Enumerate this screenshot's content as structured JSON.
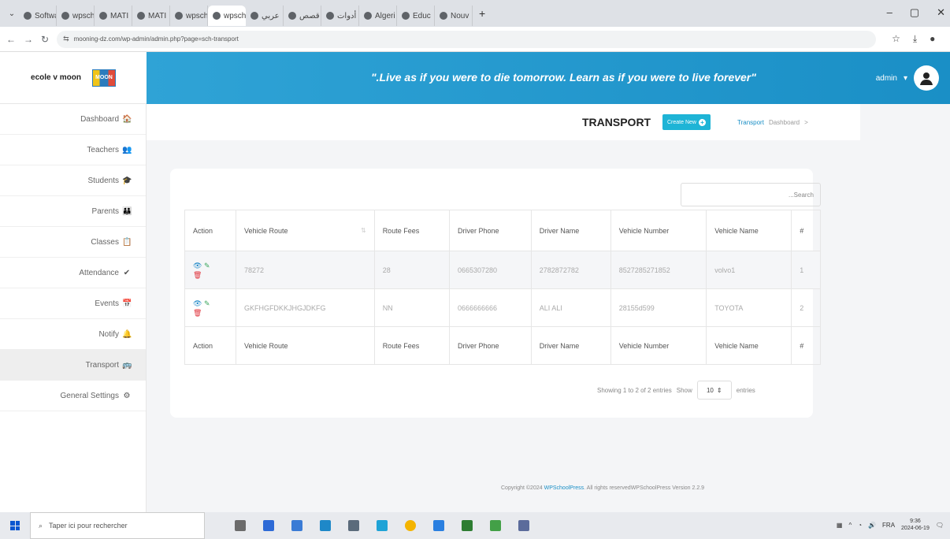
{
  "browser": {
    "tabs": [
      {
        "label": "Softwa"
      },
      {
        "label": "wpsch"
      },
      {
        "label": "MATI"
      },
      {
        "label": "MATI"
      },
      {
        "label": "wpsch"
      },
      {
        "label": "wpsch",
        "active": true
      },
      {
        "label": "عربي"
      },
      {
        "label": "قصص"
      },
      {
        "label": "أدوات"
      },
      {
        "label": "Algeri"
      },
      {
        "label": "Educ"
      },
      {
        "label": "Nouv"
      }
    ],
    "url": "mooning-dz.com/wp-admin/admin.php?page=sch-transport",
    "win_min": "–",
    "win_max": "▢",
    "win_close": "✕"
  },
  "app": {
    "brand_name": "ecole v moon",
    "brand_logo_text": "MOON",
    "quote": "\".Live as if you were to die tomorrow. Learn as if you were to live forever\"",
    "user_name": "admin",
    "sidebar": [
      {
        "label": "Dashboard",
        "icon": "🏠"
      },
      {
        "label": "Teachers",
        "icon": "👥"
      },
      {
        "label": "Students",
        "icon": "🎓"
      },
      {
        "label": "Parents",
        "icon": "👪"
      },
      {
        "label": "Classes",
        "icon": "📋"
      },
      {
        "label": "Attendance",
        "icon": "✔"
      },
      {
        "label": "Events",
        "icon": "📅"
      },
      {
        "label": "Notify",
        "icon": "🔔"
      },
      {
        "label": "Transport",
        "icon": "🚌",
        "active": true
      },
      {
        "label": "General Settings",
        "icon": "⚙"
      }
    ],
    "page_title": "TRANSPORT",
    "create_new": "Create New",
    "breadcrumb": {
      "current": "Transport",
      "parent": "Dashboard",
      "sep": ">"
    },
    "search_placeholder": "...Search",
    "table": {
      "headers": [
        "Action",
        "Vehicle Route",
        "Route Fees",
        "Driver Phone",
        "Driver Name",
        "Vehicle Number",
        "Vehicle Name",
        "#"
      ],
      "rows": [
        [
          "",
          "78272",
          "28",
          "0665307280",
          "2782872782",
          "8527285271852",
          "volvo1",
          "1"
        ],
        [
          "",
          "GKFHGFDKKJHGJDKFG",
          "NN",
          "0666666666",
          "ALI ALI",
          "28155d599",
          "TOYOTA",
          "2"
        ]
      ]
    },
    "showing": "Showing 1 to 2 of 2 entries",
    "show_label": "Show",
    "page_length": "10",
    "entries_label": "entries",
    "copyright_pre": "Copyright ©2024",
    "copyright_brand": "WPSchoolPress",
    "copyright_post": ". All rights reservedWPSchoolPress Version 2.2.9"
  },
  "taskbar": {
    "search_placeholder": "Taper ici pour rechercher",
    "lang": "FRA",
    "time": "9:36",
    "date": "2024-06-19"
  },
  "colors": {
    "accent": "#1a8fc6",
    "create_button": "#1eb4d6",
    "delete": "#e0333b",
    "edit": "#3aa65c"
  }
}
